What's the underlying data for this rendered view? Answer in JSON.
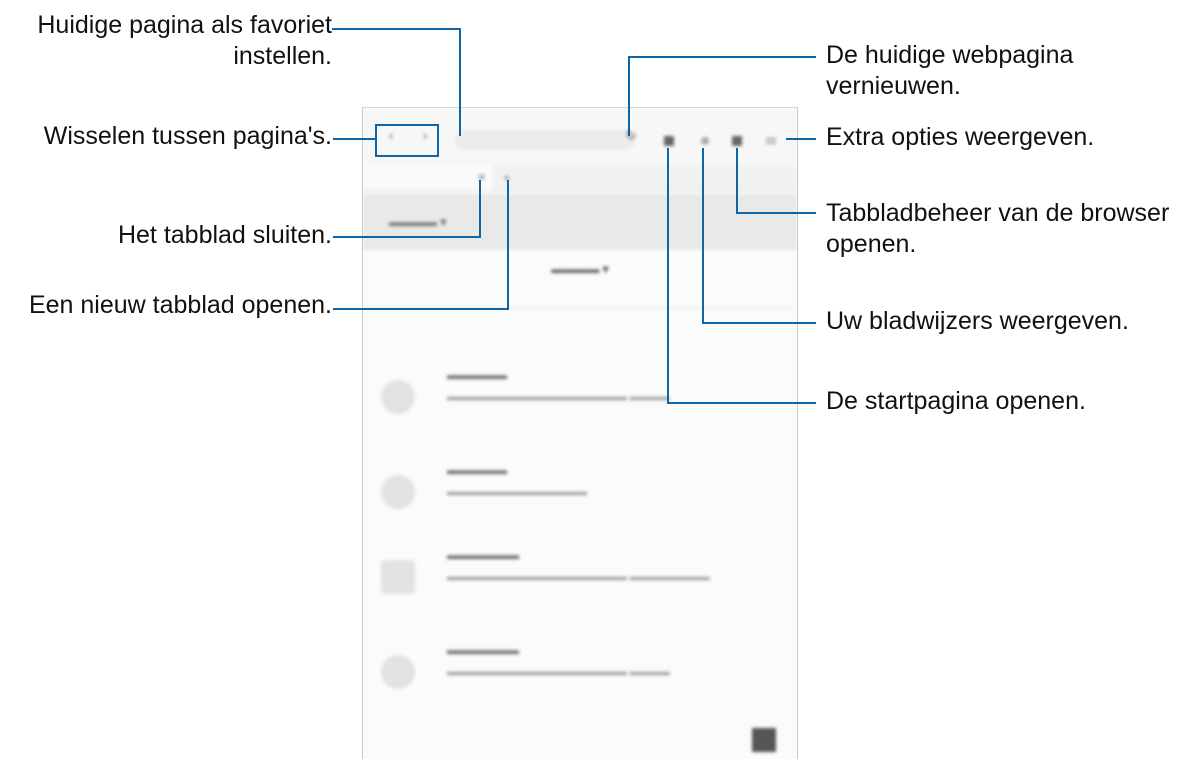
{
  "callouts": {
    "favorite": "Huidige pagina als favoriet\ninstellen.",
    "switch_pages": "Wisselen tussen pagina's.",
    "close_tab": "Het tabblad sluiten.",
    "new_tab": "Een nieuw tabblad openen.",
    "refresh": "De huidige webpagina\nvernieuwen.",
    "more_options": "Extra opties weergeven.",
    "tab_manager": "Tabbladbeheer van de browser\nopenen.",
    "bookmarks": "Uw bladwijzers weergeven.",
    "home": "De startpagina openen."
  },
  "screen": {
    "icons": {
      "back": "chevron-left-icon",
      "forward": "chevron-right-icon",
      "favorite": "star-icon",
      "refresh": "refresh-icon",
      "home": "home-icon",
      "bookmarks": "bookmark-icon",
      "tabs": "tab-manager-icon",
      "more": "menu-icon",
      "close": "close-icon",
      "add": "plus-icon"
    }
  },
  "colors": {
    "leader_line": "#0f66a6"
  }
}
